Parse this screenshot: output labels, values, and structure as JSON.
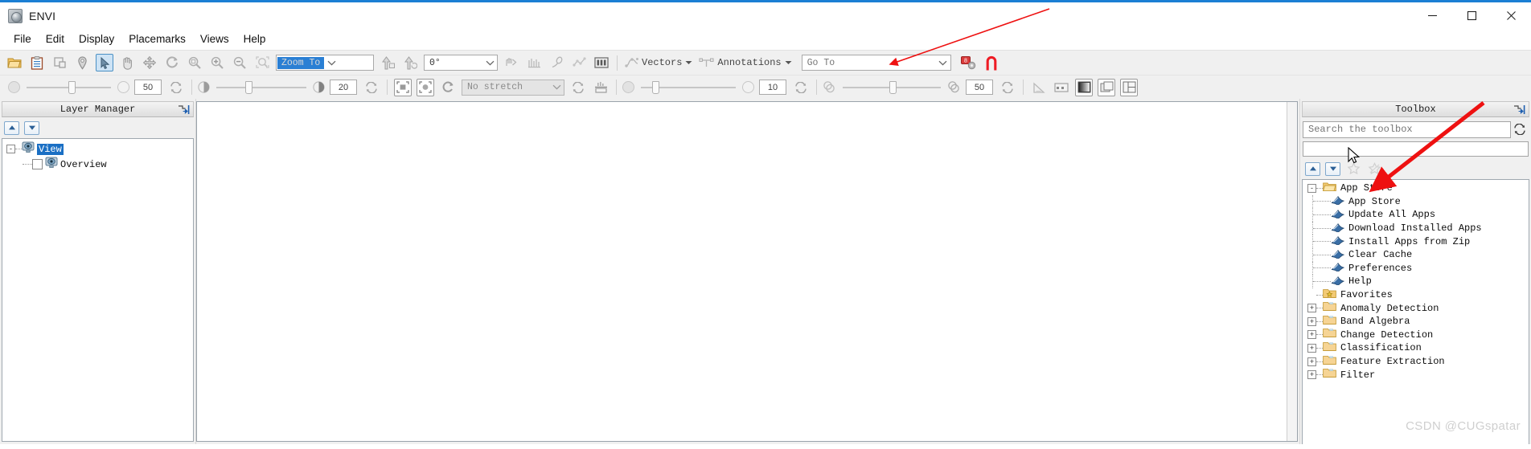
{
  "window": {
    "title": "ENVI",
    "app_icon": "envi-globe-icon",
    "controls": {
      "minimize": "minimize-icon",
      "maximize": "maximize-icon",
      "close": "close-icon"
    },
    "accent_color": "#1b7fd4"
  },
  "menubar": {
    "items": [
      {
        "label": "File"
      },
      {
        "label": "Edit"
      },
      {
        "label": "Display"
      },
      {
        "label": "Placemarks"
      },
      {
        "label": "Views"
      },
      {
        "label": "Help"
      }
    ]
  },
  "toolbar_row1": {
    "buttons": [
      {
        "name": "open-file-icon",
        "tip": "Open"
      },
      {
        "name": "clipboard-icon",
        "tip": "Open Recent"
      },
      {
        "name": "crop-icon",
        "tip": "Subset"
      },
      {
        "name": "placemark-pin-icon",
        "tip": "Placemark"
      },
      {
        "name": "select-arrow-icon",
        "tip": "Select",
        "selected": true
      },
      {
        "name": "pan-hand-icon",
        "tip": "Pan"
      },
      {
        "name": "fly-move-icon",
        "tip": "Fly"
      },
      {
        "name": "rotate-icon",
        "tip": "Rotate"
      },
      {
        "name": "zoom-fit-icon",
        "tip": "Zoom to Fit"
      },
      {
        "name": "zoom-in-icon",
        "tip": "Zoom In"
      },
      {
        "name": "zoom-out-icon",
        "tip": "Zoom Out"
      },
      {
        "name": "zoom-select-icon",
        "tip": "Zoom to Selection"
      }
    ],
    "zoom_combo": {
      "value": "Zoom To",
      "selected": true
    },
    "after_zoom_buttons": [
      {
        "name": "rotate-north-up-icon",
        "tip": "North Up"
      },
      {
        "name": "rotate-image-icon",
        "tip": "Rotate Image"
      }
    ],
    "rotation_combo": {
      "value": "0°"
    },
    "tool_buttons": [
      {
        "name": "cursor-value-icon",
        "tip": "Cursor Value"
      },
      {
        "name": "spectral-profile-icon",
        "tip": "Spectral Profile"
      },
      {
        "name": "roi-pencil-icon",
        "tip": "Region of Interest"
      },
      {
        "name": "mensuration-icon",
        "tip": "Mensuration"
      },
      {
        "name": "band-slider-icon",
        "tip": "Band Slider"
      }
    ],
    "vectors_menu": {
      "label": "Vectors",
      "icon": "vectors-icon"
    },
    "annotations_menu": {
      "label": "Annotations",
      "icon": "annotations-icon"
    },
    "goto_combo": {
      "placeholder": "Go To"
    },
    "extra_buttons": [
      {
        "name": "chip-display-icon",
        "tip": "Chip to ArcMap"
      },
      {
        "name": "red-a-annotation-icon",
        "tip": "Annotation Text Tool",
        "color": "#ee1c25"
      }
    ]
  },
  "toolbar_row2": {
    "transparency": {
      "value": "50",
      "icon_left": "opaque-circle-icon",
      "icon_right": "transparent-circle-icon",
      "refresh": "refresh-icon"
    },
    "brightness": {
      "value": "20",
      "icon_left": "brightness-low-icon",
      "icon_right": "brightness-high-icon",
      "refresh": "refresh-icon"
    },
    "view_buttons": [
      {
        "name": "full-extent-icon",
        "selected": true
      },
      {
        "name": "fit-to-window-icon",
        "selected": true
      }
    ],
    "reset_stretch": {
      "name": "reset-stretch-icon"
    },
    "stretch_combo": {
      "value": "No stretch",
      "disabled": true
    },
    "stretch_refresh": {
      "name": "refresh-icon"
    },
    "histogram_btn": {
      "name": "histogram-stretch-icon"
    },
    "contrast": {
      "value": "10",
      "icon_left": "contrast-circle-icon",
      "icon_right": "contrast-circle-icon",
      "refresh": "refresh-icon"
    },
    "sharpen": {
      "value": "50",
      "icon_left": "sharpen-icon",
      "icon_right": "sharpen-icon",
      "refresh": "refresh-icon"
    },
    "right_buttons": [
      {
        "name": "measure-angle-icon"
      },
      {
        "name": "scale-bar-icon"
      },
      {
        "name": "single-view-icon",
        "selected": true
      },
      {
        "name": "stacked-views-icon",
        "selected": true
      },
      {
        "name": "split-views-icon",
        "selected": true
      }
    ]
  },
  "layer_manager": {
    "title": "Layer Manager",
    "pin_icon": "panel-pin-icon",
    "up_button": "move-up-icon",
    "down_button": "move-down-icon",
    "tree": [
      {
        "label": "View",
        "icon": "view-monitor-icon",
        "expander": "-",
        "selected": true,
        "children": [
          {
            "label": "Overview",
            "icon": "view-monitor-icon",
            "checkbox": false
          }
        ]
      }
    ]
  },
  "toolbox": {
    "title": "Toolbox",
    "pin_icon": "panel-pin-icon",
    "search": {
      "placeholder": "Search the toolbox"
    },
    "search_refresh_icon": "refresh-icon",
    "second_field": {
      "value": ""
    },
    "up_button": "move-up-icon",
    "down_button": "move-down-icon",
    "add_favorite_icon": "star-add-icon",
    "remove_favorite_icon": "star-remove-icon",
    "tree": [
      {
        "label": "App Store",
        "type": "folder-open",
        "expander": "-",
        "children": [
          {
            "label": "App Store",
            "type": "tool"
          },
          {
            "label": "Update All Apps",
            "type": "tool"
          },
          {
            "label": "Download Installed Apps",
            "type": "tool"
          },
          {
            "label": "Install Apps from Zip",
            "type": "tool"
          },
          {
            "label": "Clear Cache",
            "type": "tool"
          },
          {
            "label": "Preferences",
            "type": "tool"
          },
          {
            "label": "Help",
            "type": "tool"
          }
        ]
      },
      {
        "label": "Favorites",
        "type": "folder-star",
        "expander": ""
      },
      {
        "label": "Anomaly Detection",
        "type": "folder",
        "expander": "+"
      },
      {
        "label": "Band Algebra",
        "type": "folder",
        "expander": "+"
      },
      {
        "label": "Change Detection",
        "type": "folder",
        "expander": "+"
      },
      {
        "label": "Classification",
        "type": "folder",
        "expander": "+"
      },
      {
        "label": "Feature Extraction",
        "type": "folder",
        "expander": "+"
      },
      {
        "label": "Filter",
        "type": "folder",
        "expander": "+"
      }
    ]
  },
  "watermark": {
    "text": "CSDN @CUGspatar"
  },
  "annotations": {
    "arrow_thin": {
      "color": "#ee1111",
      "target": "red-a-annotation-icon"
    },
    "arrow_thick": {
      "color": "#ee1111",
      "target": "toolbox-app-store-node"
    },
    "mouse_cursor": {
      "name": "mouse-pointer-cursor"
    }
  }
}
